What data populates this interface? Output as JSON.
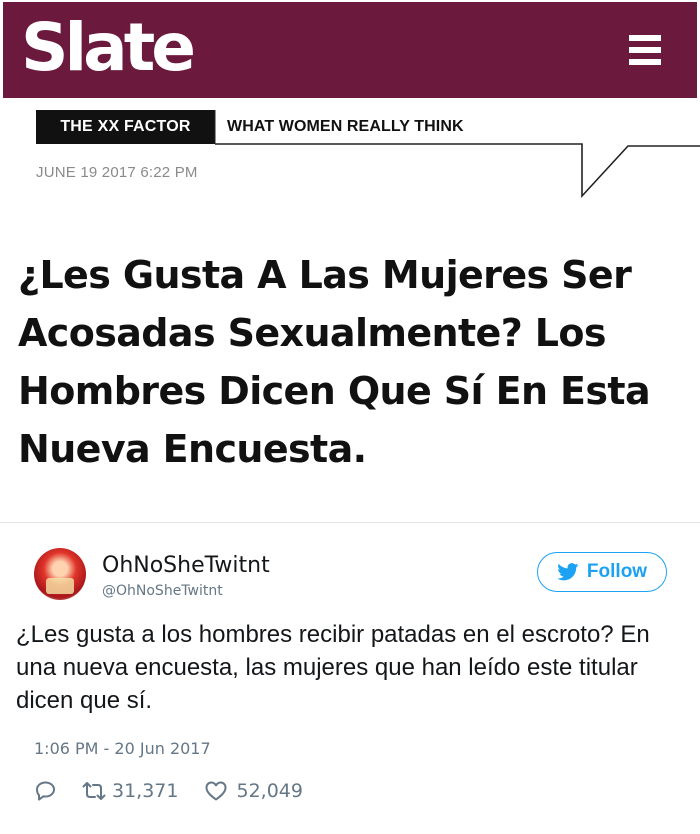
{
  "article": {
    "brand": "Slate",
    "section_label": "THE XX FACTOR",
    "section_tagline": "WHAT WOMEN REALLY THINK",
    "date": "JUNE 19 2017 6:22 PM",
    "title": "¿Les Gusta A Las Mujeres Ser Acosadas Sexualmente? Los Hombres Dicen Que Sí En Esta Nueva Encuesta."
  },
  "tweet": {
    "display_name": "OhNoSheTwitnt",
    "handle": "@OhNoSheTwitnt",
    "follow_label": "Follow",
    "text": "¿Les gusta a los hombres recibir patadas en el escroto? En una nueva encuesta, las mujeres que han leído este titular dicen que sí.",
    "timestamp": "1:06 PM - 20 Jun 2017",
    "retweets": "31,371",
    "likes": "52,049"
  },
  "colors": {
    "slate_brand": "#6b1a3e",
    "twitter_blue": "#1da1f2",
    "muted_text": "#657786"
  },
  "icons": [
    "menu-icon",
    "twitter-bird-icon",
    "reply-icon",
    "retweet-icon",
    "heart-icon"
  ]
}
